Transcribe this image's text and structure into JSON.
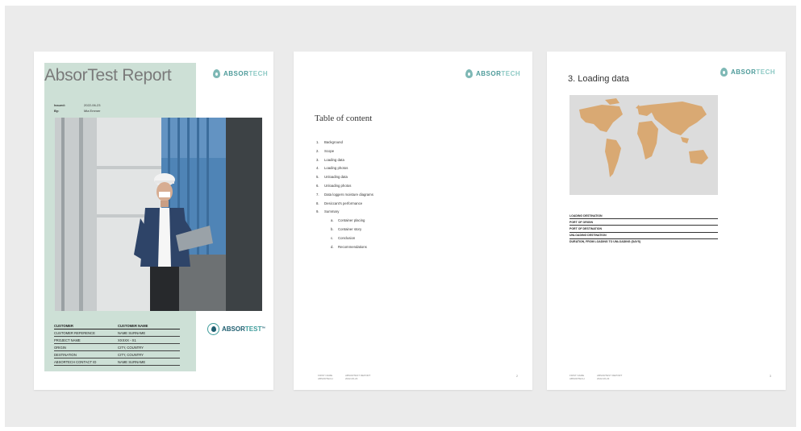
{
  "logo": {
    "brand_main": "ABSOR",
    "brand_accent": "TECH"
  },
  "cover": {
    "title": "AbsorTest Report",
    "issued_label": "Issued:",
    "issued_value": "2022-06-23",
    "by_label": "By:",
    "by_value": "Mia Emmer",
    "table_headers": [
      "CUSTOMER",
      "CUSTOMER NAME"
    ],
    "table_rows": [
      [
        "CUSTOMER REFERENCE",
        "NAME SURNAME"
      ],
      [
        "PROJECT NAME",
        "XXXXX - X1"
      ],
      [
        "ORIGIN",
        "CITY, COUNTRY"
      ],
      [
        "DESTINATION",
        "CITY, COUNTRY"
      ],
      [
        "ABSORTECH CONTACT ID",
        "NAME SURNAME"
      ]
    ],
    "brand2_main": "ABSOR",
    "brand2_accent": "TEST",
    "brand2_tm": "TM",
    "colors": {
      "panel": "#cde0d6",
      "accent": "#3e9c9b"
    }
  },
  "toc_page": {
    "title": "Table of content",
    "items": [
      {
        "n": "1.",
        "label": "Background"
      },
      {
        "n": "2.",
        "label": "Scope"
      },
      {
        "n": "3.",
        "label": "Loading data"
      },
      {
        "n": "4.",
        "label": "Loading photos"
      },
      {
        "n": "5.",
        "label": "Unloading data"
      },
      {
        "n": "6.",
        "label": "Unloading photos"
      },
      {
        "n": "7.",
        "label": "Data loggers moisture diagrams"
      },
      {
        "n": "8.",
        "label": "Desiccant's performance"
      },
      {
        "n": "9.",
        "label": "Summary"
      }
    ],
    "subitems": [
      {
        "n": "a.",
        "label": "Container placing"
      },
      {
        "n": "b.",
        "label": "Container story"
      },
      {
        "n": "c.",
        "label": "Conclusion"
      },
      {
        "n": "d.",
        "label": "Recommendations"
      }
    ],
    "footer_left": [
      "FIRST NAME",
      "ABSORTECH"
    ],
    "footer_mid": [
      "ABSORTEST REPORT",
      "2022-06-23"
    ],
    "page_number": "2"
  },
  "loading_page": {
    "title": "3.   Loading data",
    "spec_rows": [
      "LOADING DESTINATION",
      "PORT OF ORIGIN",
      "PORT OF DESTINATION",
      "UNLOADING DESTINATION",
      "DURATION, FROM LOADING TO UNLOADING (DAYS)"
    ],
    "footer_left": [
      "FIRST NAME",
      "ABSORTECH"
    ],
    "footer_mid": [
      "ABSORTEST REPORT",
      "2022-06-23"
    ],
    "page_number": "3"
  }
}
